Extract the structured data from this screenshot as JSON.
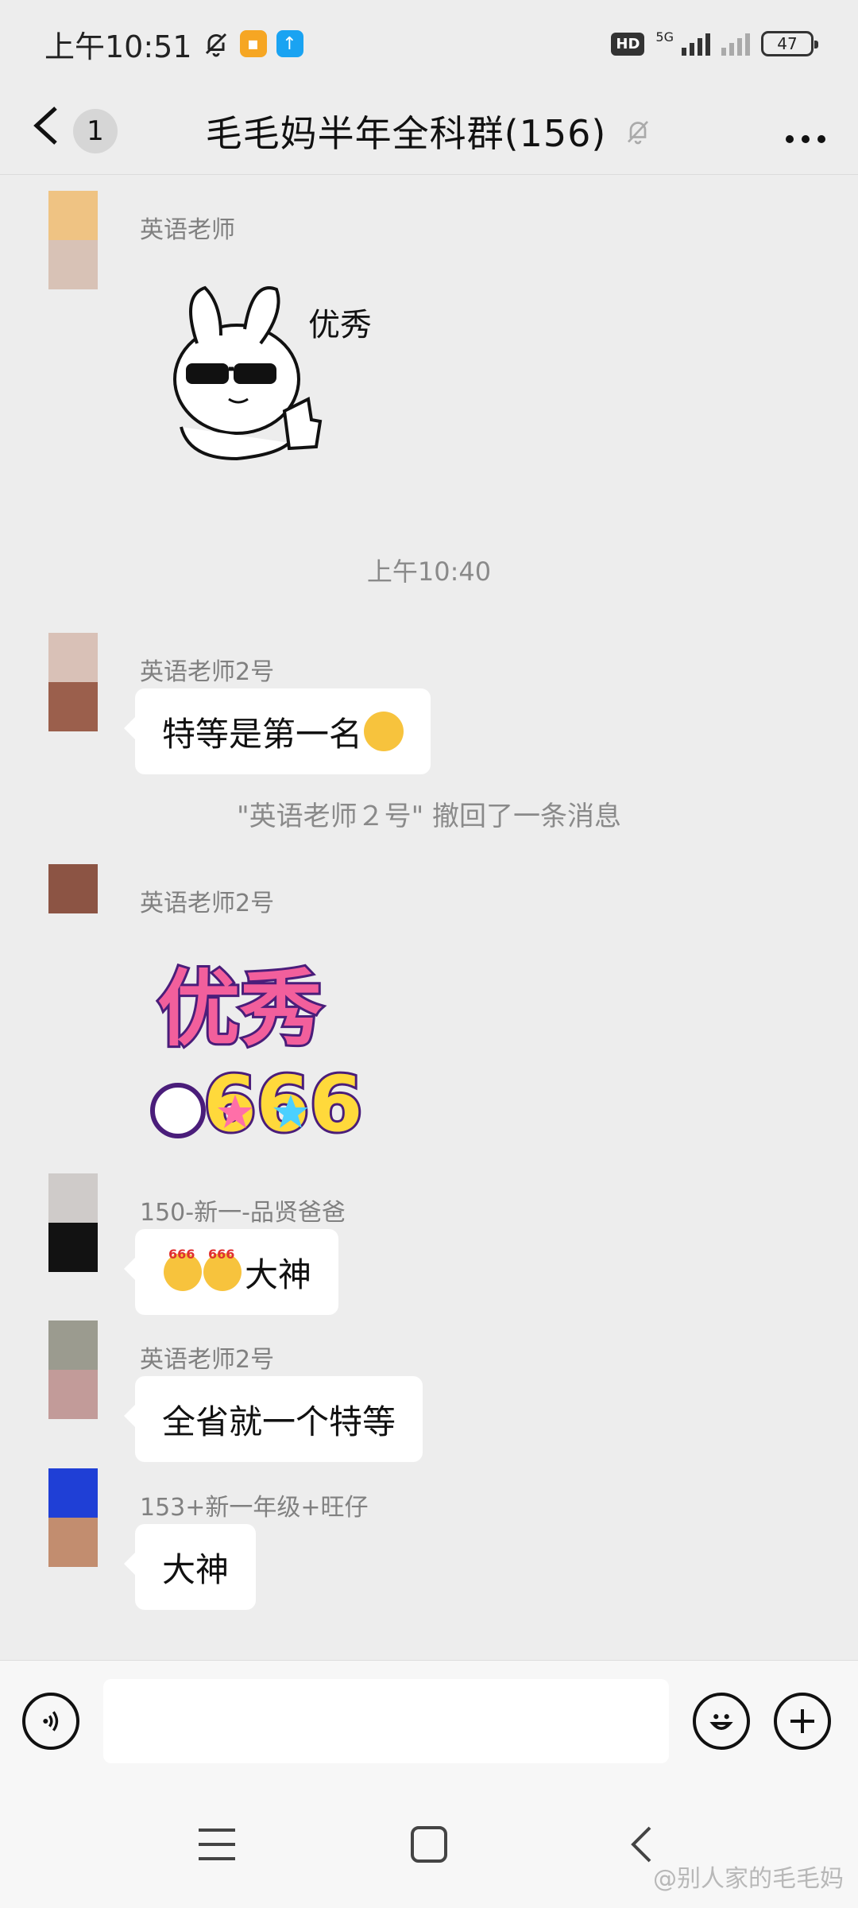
{
  "status_bar": {
    "time": "上午10:51",
    "network": "5G",
    "hd": "HD",
    "battery": "47"
  },
  "nav": {
    "unread": "1",
    "title": "毛毛妈半年全科群(156)"
  },
  "messages": [
    {
      "sender": "英语老师",
      "type": "sticker",
      "sticker_text": "优秀",
      "sticker_desc": "cool bunny thumbs up"
    },
    {
      "type": "time",
      "text": "上午10:40"
    },
    {
      "sender": "英语老师2号",
      "type": "text",
      "text": "特等是第一名",
      "emoji": "face-with-hand-over-mouth"
    },
    {
      "type": "recall",
      "text": "\"英语老师２号\" 撤回了一条消息"
    },
    {
      "sender": "英语老师2号",
      "type": "sticker",
      "sticker_text": "优秀",
      "sticker_num": "666"
    },
    {
      "sender": "150-新一-品贤爸爸",
      "type": "text",
      "text": "大神",
      "emoji_prefix": [
        "666-emoji",
        "666-emoji"
      ],
      "emoji_label": "666"
    },
    {
      "sender": "英语老师2号",
      "type": "text",
      "text": "全省就一个特等"
    },
    {
      "sender": "153+新一年级+旺仔",
      "type": "text",
      "text": "大神"
    }
  ],
  "watermark": "@别人家的毛毛妈",
  "colors": {
    "background": "#ededed",
    "bubble": "#ffffff",
    "muted_text": "#808080"
  }
}
